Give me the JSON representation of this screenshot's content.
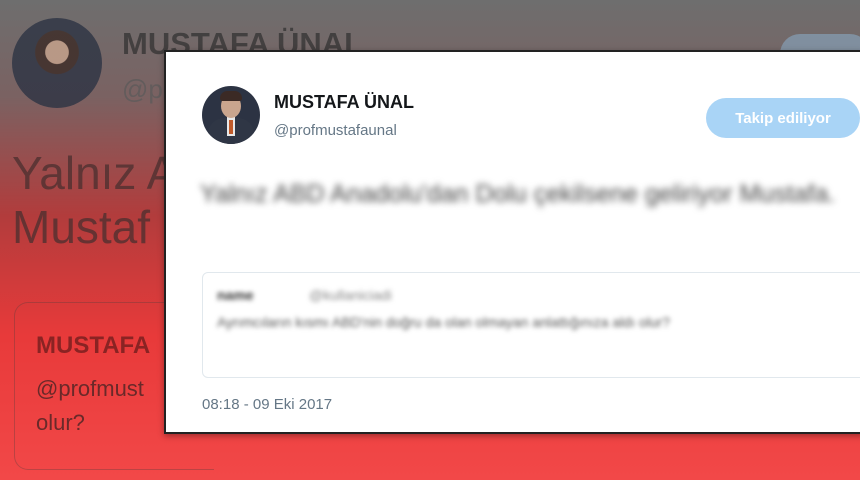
{
  "background": {
    "name": "MUSTAFA ÜNAL",
    "handle": "@p",
    "text_line1": "Yalnız A",
    "text_line2": "Mustaf",
    "quote_name": "MUSTAFA",
    "quote_handle": "@profmust",
    "quote_text": "olur?"
  },
  "tweet": {
    "author_name": "MUSTAFA ÜNAL",
    "author_handle": "@profmustafaunal",
    "follow_label": "Takip ediliyor",
    "text": "Yalnız ABD Anadolu'dan Dolu çekilsene geliriyor Mustafa.",
    "quote": {
      "name": "name",
      "handle": "@kullaniciadi",
      "text": "Ayrımcıların kısmı ABD'nin doğru da olan olmayan anlattığınıza aldı olur?"
    },
    "timestamp": "08:18 - 09 Eki 2017"
  },
  "colors": {
    "follow_button": "#a9d4f6",
    "background_gradient_bottom": "#f24848",
    "handle_gray": "#657786"
  }
}
